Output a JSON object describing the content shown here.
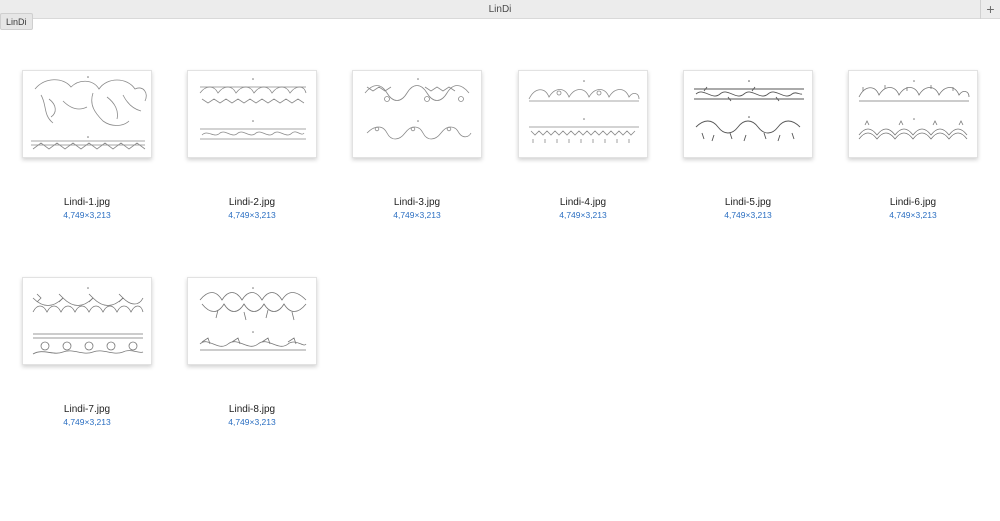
{
  "window": {
    "title": "LinDi",
    "new_tab_label": "+",
    "path_label": "LinDi",
    "accent_color": "#2b6fc2"
  },
  "files": [
    {
      "name": "Lindi-1.jpg",
      "dims": "4,749×3,213"
    },
    {
      "name": "Lindi-2.jpg",
      "dims": "4,749×3,213"
    },
    {
      "name": "Lindi-3.jpg",
      "dims": "4,749×3,213"
    },
    {
      "name": "Lindi-4.jpg",
      "dims": "4,749×3,213"
    },
    {
      "name": "Lindi-5.jpg",
      "dims": "4,749×3,213"
    },
    {
      "name": "Lindi-6.jpg",
      "dims": "4,749×3,213"
    },
    {
      "name": "Lindi-7.jpg",
      "dims": "4,749×3,213"
    },
    {
      "name": "Lindi-8.jpg",
      "dims": "4,749×3,213"
    }
  ]
}
